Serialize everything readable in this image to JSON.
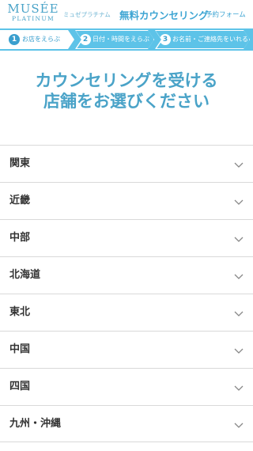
{
  "header": {
    "logo_main": "MUSÉE",
    "logo_sub": "PLATINUM",
    "logo_kana": "ミュゼプラチナム",
    "title": "無料カウンセリング",
    "subtitle": "予約フォーム"
  },
  "steps": [
    {
      "number": "1",
      "label": "お店をえらぶ",
      "active": true
    },
    {
      "number": "2",
      "label": "日付・時間をえらぶ",
      "active": false
    },
    {
      "number": "3",
      "label": "お名前・ご連絡先をいれる",
      "active": false
    }
  ],
  "page_title": {
    "line1": "カウンセリングを受ける",
    "line2": "店舗をお選びください"
  },
  "regions": [
    {
      "label": "関東",
      "icon": "chevron-down-icon"
    },
    {
      "label": "近畿",
      "icon": "chevron-down-icon"
    },
    {
      "label": "中部",
      "icon": "chevron-down-icon"
    },
    {
      "label": "北海道",
      "icon": "chevron-down-icon"
    },
    {
      "label": "東北",
      "icon": "chevron-down-icon"
    },
    {
      "label": "中国",
      "icon": "chevron-down-icon"
    },
    {
      "label": "四国",
      "icon": "chevron-down-icon"
    },
    {
      "label": "九州・沖縄",
      "icon": "chevron-down-icon"
    }
  ],
  "colors": {
    "brand": "#4aa3c8",
    "step_bar": "#5dc3e8",
    "divider": "#d9d9d9"
  }
}
